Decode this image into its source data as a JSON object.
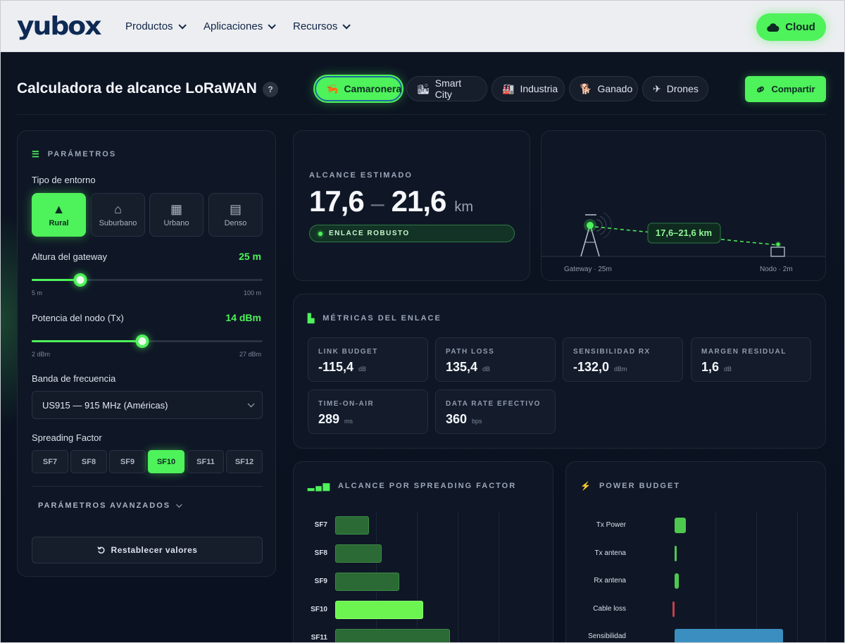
{
  "navbar": {
    "brand": "yubox",
    "menu": [
      "Productos",
      "Aplicaciones",
      "Recursos"
    ],
    "cloud_label": "Cloud"
  },
  "header": {
    "title": "Calculadora de alcance LoRaWAN",
    "help": "?",
    "presets": [
      {
        "icon": "shrimp-icon",
        "glyph": "🦐",
        "label": "Camaronera"
      },
      {
        "icon": "building-icon",
        "glyph": "🏙",
        "label": "Smart City"
      },
      {
        "icon": "factory-icon",
        "glyph": "🏭",
        "label": "Industria"
      },
      {
        "icon": "dog-icon",
        "glyph": "🐕",
        "label": "Ganado"
      },
      {
        "icon": "plane-icon",
        "glyph": "✈",
        "label": "Drones"
      }
    ],
    "share_label": "Compartir"
  },
  "params": {
    "title": "PARÁMETROS",
    "env_label": "Tipo de entorno",
    "env_options": [
      {
        "label": "Rural",
        "icon": "tree-icon",
        "glyph": "▲"
      },
      {
        "label": "Suburbano",
        "icon": "house-icon",
        "glyph": "⌂"
      },
      {
        "label": "Urbano",
        "icon": "building-icon",
        "glyph": "▦"
      },
      {
        "label": "Denso",
        "icon": "city-icon",
        "glyph": "▤"
      }
    ],
    "gateway_label": "Altura del gateway",
    "gateway_value": "25 m",
    "gateway_fraction": 0.21,
    "gateway_min": "5 m",
    "gateway_max": "100 m",
    "tx_label": "Potencia del nodo (Tx)",
    "tx_value": "14 dBm",
    "tx_fraction": 0.48,
    "tx_min": "2 dBm",
    "tx_max": "27 dBm",
    "band_label": "Banda de frecuencia",
    "band_value": "US915 — 915 MHz (Américas)",
    "sf_label": "Spreading Factor",
    "sf_options": [
      "SF7",
      "SF8",
      "SF9",
      "SF10",
      "SF11",
      "SF12"
    ],
    "sf_selected": "SF10",
    "advanced_label": "PARÁMETROS AVANZADOS",
    "reset_label": "Restablecer valores"
  },
  "range": {
    "label": "ALCANCE ESTIMADO",
    "min": "17,6",
    "dash": "–",
    "max": "21,6",
    "unit": "km",
    "status": "ENLACE ROBUSTO"
  },
  "diagram": {
    "link_label": "17,6–21,6 km",
    "gateway_label": "Gateway · 25m",
    "node_label": "Nodo · 2m"
  },
  "metrics": {
    "title": "MÉTRICAS DEL ENLACE",
    "tiles": [
      {
        "name": "LINK BUDGET",
        "value": "-115,4",
        "unit": "dB"
      },
      {
        "name": "PATH LOSS",
        "value": "135,4",
        "unit": "dB"
      },
      {
        "name": "SENSIBILIDAD RX",
        "value": "-132,0",
        "unit": "dBm"
      },
      {
        "name": "MARGEN RESIDUAL",
        "value": "1,6",
        "unit": "dB"
      },
      {
        "name": "TIME-ON-AIR",
        "value": "289",
        "unit": "ms"
      },
      {
        "name": "DATA RATE EFECTIVO",
        "value": "360",
        "unit": "bps"
      }
    ]
  },
  "sf_chart": {
    "title": "ALCANCE POR SPREADING FACTOR",
    "colors": {
      "normal": "#2b6a34",
      "highlight": "#6cf550"
    }
  },
  "power_chart": {
    "title": "POWER BUDGET",
    "colors": {
      "positive": "#4ec94f",
      "negative": "#c4404a",
      "sensitivity": "#3b8fc0"
    }
  },
  "chart_data": [
    {
      "type": "bar",
      "title": "ALCANCE POR SPREADING FACTOR",
      "categories": [
        "SF7",
        "SF8",
        "SF9",
        "SF10",
        "SF11"
      ],
      "values": [
        7.6,
        10.5,
        14.5,
        19.8,
        25.8
      ],
      "highlight": "SF10",
      "xlim": [
        0,
        46
      ]
    },
    {
      "type": "bar",
      "title": "POWER BUDGET",
      "categories": [
        "Tx Power",
        "Tx antena",
        "Rx antena",
        "Cable loss",
        "Sensibilidad"
      ],
      "values": [
        14,
        2,
        5,
        -1,
        132
      ],
      "xlim": [
        0,
        180
      ]
    }
  ]
}
